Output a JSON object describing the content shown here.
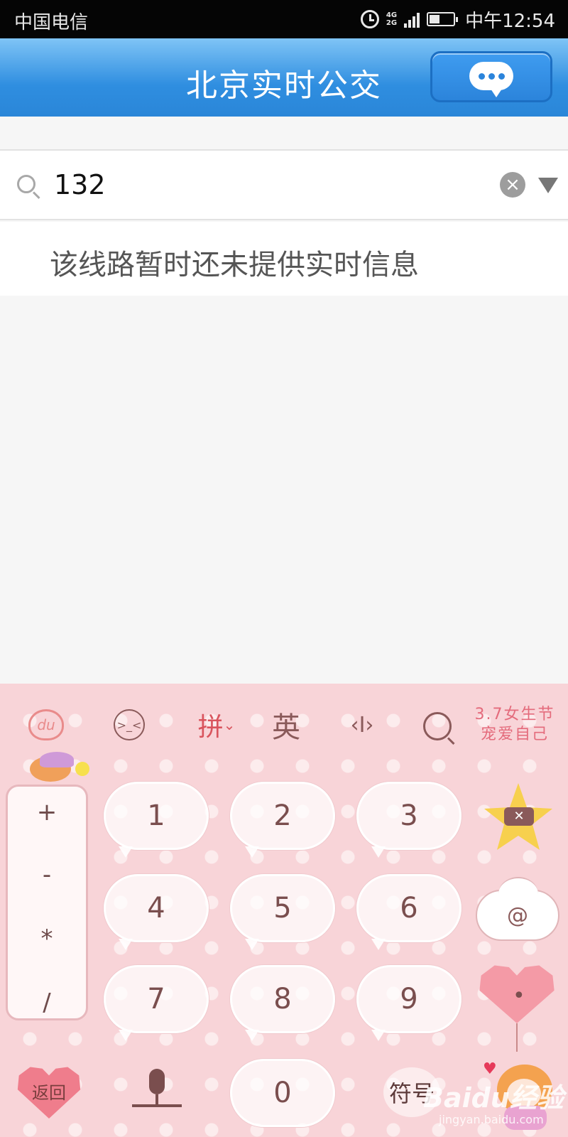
{
  "status_bar": {
    "carrier": "中国电信",
    "network_top": "4G",
    "network_bottom": "2G",
    "time": "中午12:54"
  },
  "title_bar": {
    "title": "北京实时公交",
    "message_icon": "chat-bubble-icon"
  },
  "search": {
    "value": "132",
    "icon": "search-icon",
    "clear_icon": "clear-icon",
    "dropdown_icon": "dropdown-arrow-icon"
  },
  "notice": {
    "text": "该线路暂时还未提供实时信息"
  },
  "keyboard": {
    "toolbar": {
      "logo_label": "du",
      "pinyin_label": "拼",
      "english_label": "英",
      "cursor_label": "‹I›",
      "promo_line1": "3.7女生节",
      "promo_line2": "宠爱自己"
    },
    "operators": [
      "+",
      "-",
      "*",
      "/"
    ],
    "digits": [
      "1",
      "2",
      "3",
      "4",
      "5",
      "6",
      "7",
      "8",
      "9"
    ],
    "zero": "0",
    "at_label": "@",
    "dot_label": "•",
    "back_label": "返回",
    "symbol_label": "符号",
    "colors": {
      "background": "#f8d4d8",
      "key_text": "#7a4e4e",
      "accent": "#d9545d"
    }
  },
  "watermark": {
    "brand": "Baidu经验",
    "url": "jingyan.baidu.com"
  }
}
